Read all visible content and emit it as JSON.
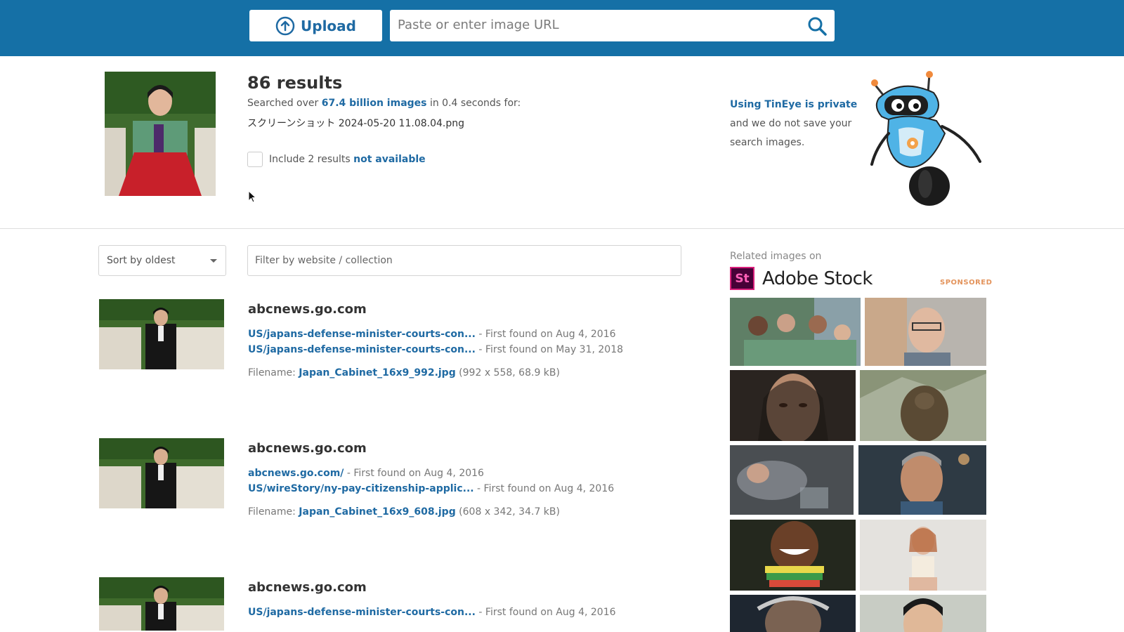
{
  "header": {
    "upload_label": "Upload",
    "url_placeholder": "Paste or enter image URL"
  },
  "summary": {
    "results_count": "86 results",
    "searched_prefix": "Searched over ",
    "searched_link": "67.4 billion images",
    "searched_suffix": " in 0.4 seconds for:",
    "query_filename": "スクリーンショット 2024-05-20 11.08.04.png",
    "include_prefix": "Include 2 results ",
    "include_link": "not available"
  },
  "privacy": {
    "link": "Using TinEye is private",
    "text": "and we do not save your search images."
  },
  "controls": {
    "sort_value": "Sort by oldest",
    "filter_placeholder": "Filter by website / collection"
  },
  "results": [
    {
      "domain": "abcnews.go.com",
      "matches": [
        {
          "url": "US/japans-defense-minister-courts-con...",
          "found": " - First found on Aug 4, 2016"
        },
        {
          "url": "US/japans-defense-minister-courts-con...",
          "found": " - First found on May 31, 2018"
        }
      ],
      "filename_label": "Filename: ",
      "filename": "Japan_Cabinet_16x9_992.jpg",
      "file_info": " (992 x 558, 68.9 kB)"
    },
    {
      "domain": "abcnews.go.com",
      "matches": [
        {
          "url": "abcnews.go.com/",
          "found": " - First found on Aug 4, 2016"
        },
        {
          "url": "US/wireStory/ny-pay-citizenship-applic...",
          "found": " - First found on Aug 4, 2016"
        }
      ],
      "filename_label": "Filename: ",
      "filename": "Japan_Cabinet_16x9_608.jpg",
      "file_info": " (608 x 342, 34.7 kB)"
    },
    {
      "domain": "abcnews.go.com",
      "matches": [
        {
          "url": "US/japans-defense-minister-courts-con...",
          "found": " - First found on Aug 4, 2016"
        }
      ]
    }
  ],
  "sidebar": {
    "related_title": "Related images on",
    "brand_mark": "St",
    "brand_name": "Adobe Stock",
    "sponsored": "SPONSORED"
  },
  "colors": {
    "header_bg": "#1570a6",
    "link": "#1f6aa3",
    "sponsored": "#e3935b",
    "adobe_brand": "#470137"
  }
}
